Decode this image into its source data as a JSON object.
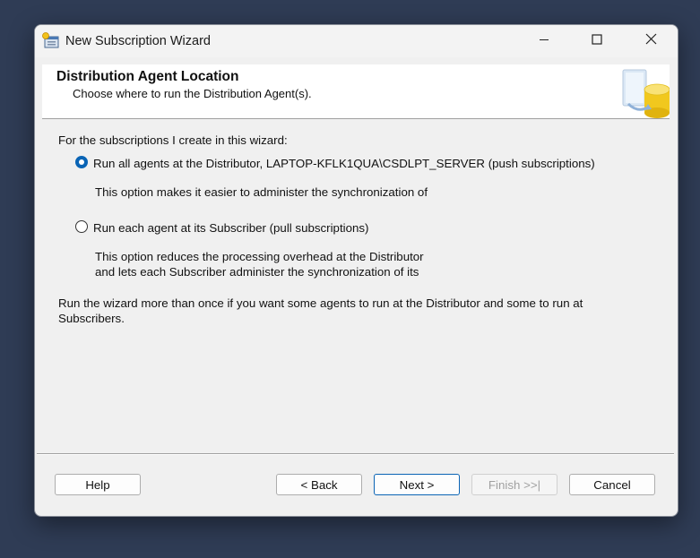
{
  "window": {
    "title": "New Subscription Wizard",
    "controls": {
      "minimize": "minimize-icon",
      "maximize": "maximize-icon",
      "close": "close-icon"
    }
  },
  "header": {
    "title": "Distribution Agent Location",
    "subtitle": "Choose where to run the Distribution Agent(s)."
  },
  "content": {
    "prompt": "For the subscriptions I create in this wizard:",
    "options": [
      {
        "label": "Run all agents at the Distributor, LAPTOP-KFLK1QUA\\CSDLPT_SERVER (push subscriptions)",
        "checked": true,
        "description": [
          "This option makes it easier to administer the synchronization of"
        ]
      },
      {
        "label": "Run each agent at its Subscriber (pull subscriptions)",
        "checked": false,
        "description": [
          "This option reduces the processing overhead at the Distributor",
          "and lets each Subscriber administer the synchronization of its"
        ]
      }
    ],
    "note_lines": [
      "Run the wizard more than once if you want some agents to run at the Distributor and some to run at",
      "Subscribers."
    ]
  },
  "buttons": {
    "help": "Help",
    "back": "< Back",
    "next": "Next >",
    "finish": "Finish >>|",
    "cancel": "Cancel"
  },
  "colors": {
    "desktop": "#2f3c55",
    "dialog": "#f0f0f0",
    "accent": "#0a64b5"
  }
}
